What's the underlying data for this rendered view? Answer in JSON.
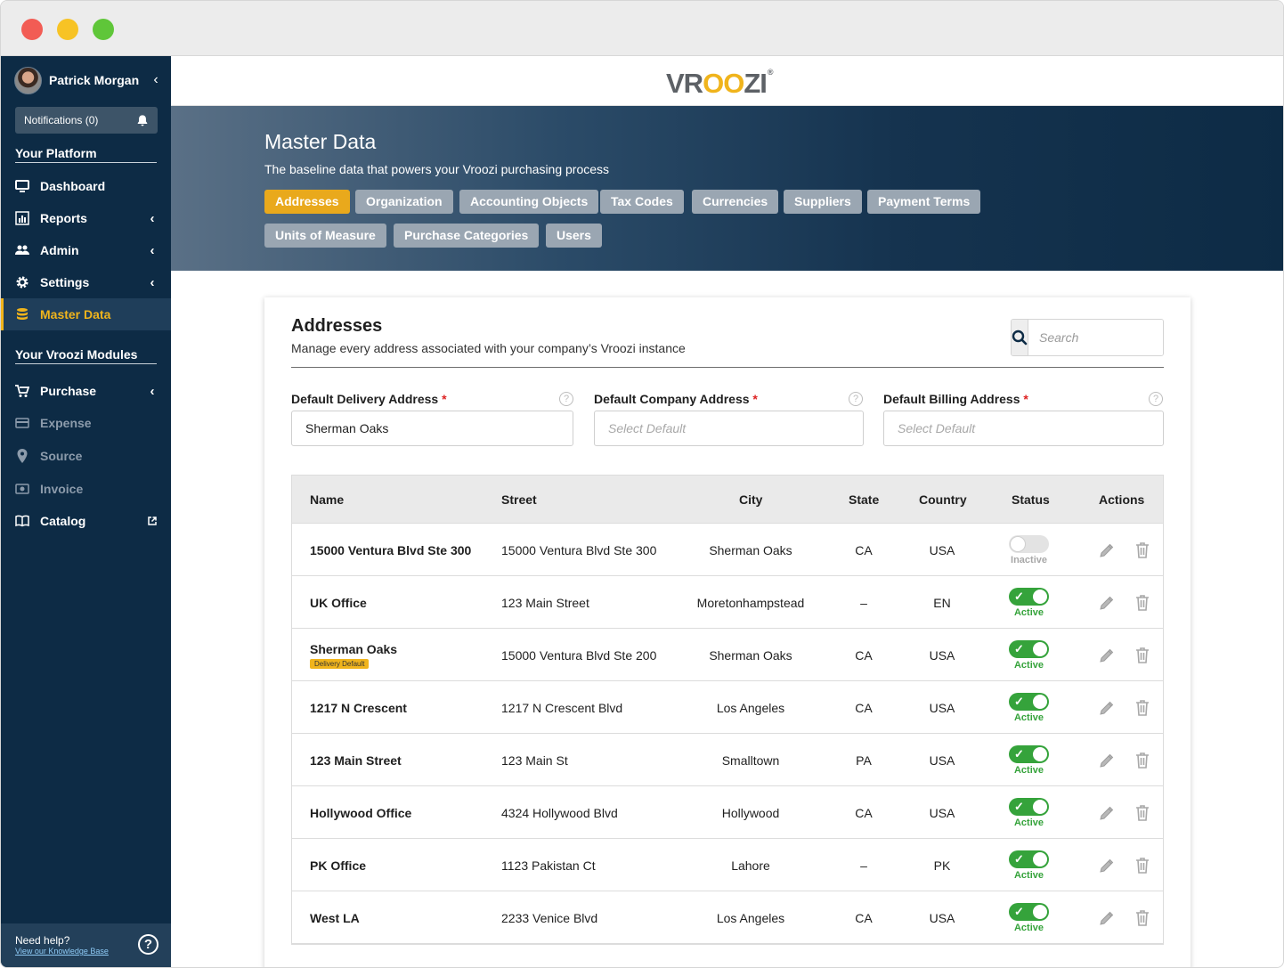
{
  "sidebar": {
    "user_name": "Patrick Morgan",
    "notifications_label": "Notifications (0)",
    "platform_title": "Your Platform",
    "platform_items": [
      {
        "label": "Dashboard",
        "icon": "monitor-icon"
      },
      {
        "label": "Reports",
        "icon": "bar-chart-icon"
      },
      {
        "label": "Admin",
        "icon": "users-icon"
      },
      {
        "label": "Settings",
        "icon": "gear-icon"
      },
      {
        "label": "Master Data",
        "icon": "database-icon",
        "active": true
      }
    ],
    "modules_title": "Your Vroozi Modules",
    "module_items": [
      {
        "label": "Purchase",
        "icon": "cart-icon"
      },
      {
        "label": "Expense",
        "icon": "credit-card-icon",
        "disabled": true
      },
      {
        "label": "Source",
        "icon": "map-pin-icon",
        "disabled": true
      },
      {
        "label": "Invoice",
        "icon": "invoice-icon",
        "disabled": true
      },
      {
        "label": "Catalog",
        "icon": "book-icon"
      }
    ],
    "help_title": "Need help?",
    "help_link": "View our Knowledge Base"
  },
  "brand": {
    "logo_text_a": "VR",
    "logo_text_b": "OO",
    "logo_text_c": "ZI",
    "accent": "#f0b41c",
    "navy": "#0d2b45"
  },
  "hero": {
    "title": "Master Data",
    "subtitle": "The baseline data that powers your Vroozi purchasing process",
    "tabs": [
      "Addresses",
      "Organization",
      "Accounting Objects",
      "Tax Codes",
      "Currencies",
      "Suppliers",
      "Payment Terms",
      "Units of Measure",
      "Purchase Categories",
      "Users"
    ]
  },
  "card": {
    "title": "Addresses",
    "subtitle": "Manage every address associated with your company’s Vroozi instance",
    "search_placeholder": "Search"
  },
  "defaults": {
    "delivery_label": "Default Delivery Address",
    "delivery_value": "Sherman Oaks",
    "company_label": "Default Company Address",
    "company_placeholder": "Select Default",
    "billing_label": "Default Billing Address",
    "billing_placeholder": "Select Default",
    "required_mark": "*",
    "help_glyph": "?"
  },
  "table": {
    "headers": [
      "Name",
      "Street",
      "City",
      "State",
      "Country",
      "Status",
      "Actions"
    ],
    "rows": [
      {
        "name": "15000 Ventura Blvd Ste 300",
        "street": "15000 Ventura Blvd Ste 300",
        "city": "Sherman Oaks",
        "state": "CA",
        "country": "USA",
        "status": "Inactive",
        "active": false
      },
      {
        "name": "UK Office",
        "street": "123 Main Street",
        "city": "Moretonhampstead",
        "state": "–",
        "country": "EN",
        "status": "Active",
        "active": true
      },
      {
        "name": "Sherman Oaks",
        "badge": "Delivery Default",
        "street": "15000 Ventura Blvd Ste 200",
        "city": "Sherman Oaks",
        "state": "CA",
        "country": "USA",
        "status": "Active",
        "active": true
      },
      {
        "name": "1217 N Crescent",
        "street": "1217 N Crescent Blvd",
        "city": "Los Angeles",
        "state": "CA",
        "country": "USA",
        "status": "Active",
        "active": true
      },
      {
        "name": "123 Main Street",
        "street": "123 Main St",
        "city": "Smalltown",
        "state": "PA",
        "country": "USA",
        "status": "Active",
        "active": true
      },
      {
        "name": "Hollywood Office",
        "street": "4324 Hollywood Blvd",
        "city": "Hollywood",
        "state": "CA",
        "country": "USA",
        "status": "Active",
        "active": true
      },
      {
        "name": "PK Office",
        "street": "1123 Pakistan Ct",
        "city": "Lahore",
        "state": "–",
        "country": "PK",
        "status": "Active",
        "active": true
      },
      {
        "name": "West LA",
        "street": "2233 Venice Blvd",
        "city": "Los Angeles",
        "state": "CA",
        "country": "USA",
        "status": "Active",
        "active": true
      }
    ]
  }
}
